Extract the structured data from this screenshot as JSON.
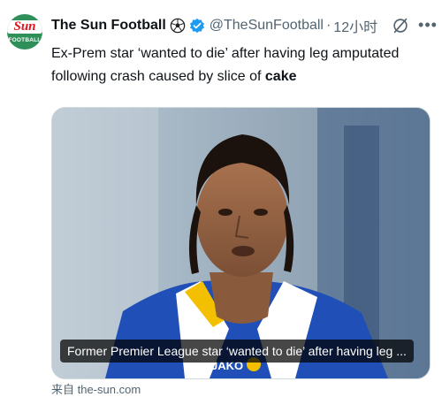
{
  "account": {
    "name": "The Sun Football",
    "handle": "@TheSunFootball",
    "separator": "·",
    "time": "12小时",
    "avatar_text_top": "Sun",
    "avatar_text_bottom": "FOOTBALL"
  },
  "tweet": {
    "text_line1": "Ex-Prem star ‘wanted to die’ after having leg amputated",
    "text_line2_plain": "following crash caused by slice of ",
    "text_line2_bold": "cake"
  },
  "media": {
    "caption": "Former Premier League star ‘wanted to die’ after having leg ...",
    "shirt_text": "JAKO"
  },
  "footer": {
    "partial_text": "来自 the-sun.com"
  },
  "icons": {
    "ball": "soccer-ball-icon",
    "verified": "verified-badge-icon",
    "grok": "grok-icon",
    "more": "more-icon"
  },
  "colors": {
    "verified_blue": "#1d9bf0",
    "secondary_text": "#536471",
    "avatar_green": "#2f8f58",
    "sun_red": "#e3141c"
  }
}
